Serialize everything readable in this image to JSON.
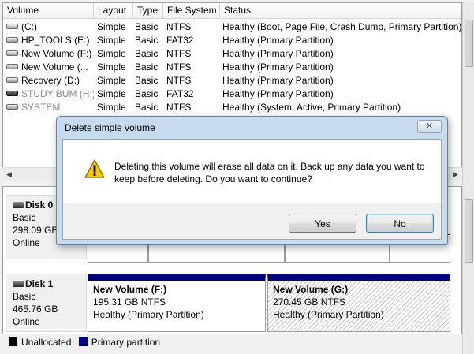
{
  "volume_list": {
    "columns": [
      "Volume",
      "Layout",
      "Type",
      "File System",
      "Status"
    ],
    "rows": [
      {
        "name": "(C:)",
        "layout": "Simple",
        "type": "Basic",
        "fs": "NTFS",
        "status": "Healthy (Boot, Page File, Crash Dump, Primary Partition)"
      },
      {
        "name": "HP_TOOLS (E:)",
        "layout": "Simple",
        "type": "Basic",
        "fs": "FAT32",
        "status": "Healthy (Primary Partition)"
      },
      {
        "name": "New Volume (F:)",
        "layout": "Simple",
        "type": "Basic",
        "fs": "NTFS",
        "status": "Healthy (Primary Partition)"
      },
      {
        "name": "New Volume (...",
        "layout": "Simple",
        "type": "Basic",
        "fs": "NTFS",
        "status": "Healthy (Primary Partition)"
      },
      {
        "name": "Recovery (D:)",
        "layout": "Simple",
        "type": "Basic",
        "fs": "NTFS",
        "status": "Healthy (Primary Partition)"
      },
      {
        "name": "STUDY BUM (H:)",
        "layout": "Simple",
        "type": "Basic",
        "fs": "FAT32",
        "status": "Healthy (Primary Partition)"
      },
      {
        "name": "SYSTEM",
        "layout": "Simple",
        "type": "Basic",
        "fs": "NTFS",
        "status": "Healthy (System, Active, Primary Partition)"
      }
    ]
  },
  "disks": [
    {
      "title": "Disk 0",
      "kind": "Basic",
      "size": "298.09 GB",
      "state": "Online"
    },
    {
      "title": "Disk 1",
      "kind": "Basic",
      "size": "465.76 GB",
      "state": "Online"
    }
  ],
  "disk1_partitions": [
    {
      "name": "New Volume  (F:)",
      "size": "195.31 GB NTFS",
      "status": "Healthy (Primary Partition)"
    },
    {
      "name": "New Volume  (G:)",
      "size": "270.45 GB NTFS",
      "status": "Healthy (Primary Partition)"
    }
  ],
  "legend": {
    "unallocated": "Unallocated",
    "primary": "Primary partition"
  },
  "dialog": {
    "title": "Delete simple volume",
    "message": "Deleting this volume will erase all data on it. Back up any data you want to keep before deleting. Do you want to continue?",
    "yes_label": "Yes",
    "no_label": "No",
    "close_glyph": "✕"
  },
  "colors": {
    "primary_partition": "#000080",
    "unallocated": "#000000"
  },
  "icons": {
    "warning": "warning-icon",
    "drive": "drive-icon",
    "disk": "disk-icon"
  }
}
